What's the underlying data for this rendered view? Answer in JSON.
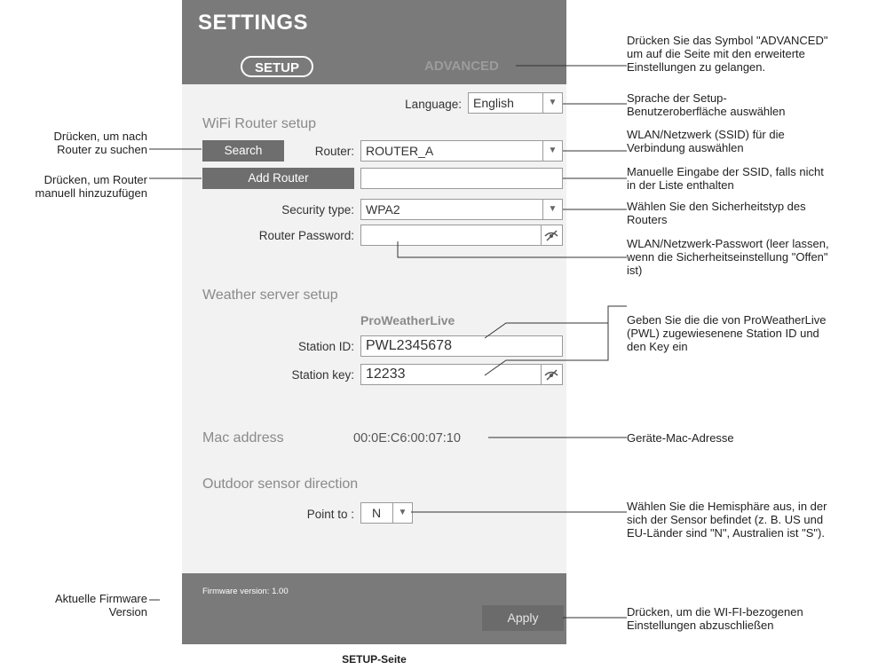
{
  "header": {
    "title": "SETTINGS",
    "tab_setup": "SETUP",
    "tab_advanced": "ADVANCED"
  },
  "language": {
    "label": "Language:",
    "value": "English"
  },
  "wifi": {
    "section_title": "WiFi Router setup",
    "search_button": "Search",
    "router_label": "Router:",
    "router_value": "ROUTER_A",
    "add_router_button": "Add Router",
    "manual_ssid_value": "",
    "security_label": "Security type:",
    "security_value": "WPA2",
    "password_label": "Router Password:",
    "password_value": ""
  },
  "weather": {
    "section_title": "Weather server setup",
    "provider": "ProWeatherLive",
    "station_id_label": "Station ID:",
    "station_id_value": "PWL2345678",
    "station_key_label": "Station key:",
    "station_key_value": "12233"
  },
  "mac": {
    "label": "Mac address",
    "value": "00:0E:C6:00:07:10"
  },
  "sensor": {
    "section_title": "Outdoor sensor direction",
    "point_label": "Point to :",
    "point_value": "N"
  },
  "footer": {
    "firmware": "Firmware version: 1.00",
    "apply_button": "Apply"
  },
  "annotations": {
    "advanced": [
      "Drücken Sie das Symbol \"ADVANCED\"",
      "um auf die Seite mit den erweiterte",
      "Einstellungen zu gelangen."
    ],
    "language": [
      "Sprache der Setup-",
      "Benutzeroberfläche auswählen"
    ],
    "router": [
      "WLAN/Netzwerk (SSID) für die",
      "Verbindung auswählen"
    ],
    "manual": [
      "Manuelle Eingabe der SSID, falls nicht",
      "in der Liste enthalten"
    ],
    "security": [
      "Wählen Sie den Sicherheitstyp des",
      "Routers"
    ],
    "password": [
      "WLAN/Netzwerk-Passwort (leer lassen,",
      "wenn die Sicherheitseinstellung \"Offen\"",
      "ist)"
    ],
    "station": [
      "Geben Sie die die von ProWeatherLive",
      "(PWL) zugewiesenene Station ID und",
      "den Key ein"
    ],
    "mac": [
      "Geräte-Mac-Adresse"
    ],
    "hemisphere": [
      "Wählen Sie die Hemisphäre aus, in der",
      "sich der Sensor befindet (z. B. US und",
      "EU-Länder sind \"N\", Australien ist \"S\")."
    ],
    "apply": [
      "Drücken, um die WI-FI-bezogenen",
      "Einstellungen abzuschließen"
    ],
    "search": [
      "Drücken, um nach",
      "Router zu suchen"
    ],
    "add_router": [
      "Drücken, um Router",
      "manuell hinzuzufügen"
    ],
    "firmware": [
      "Aktuelle Firmware",
      "Version"
    ]
  },
  "caption": "SETUP-Seite"
}
